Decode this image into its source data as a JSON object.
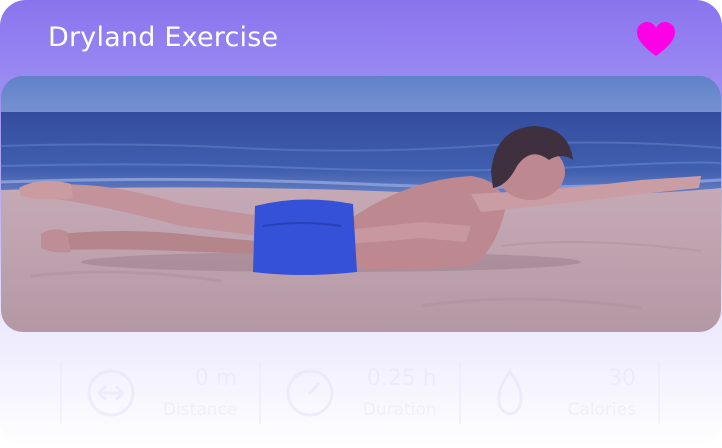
{
  "header": {
    "title": "Dryland Exercise",
    "favorite_icon": "heart-icon",
    "favorite_color": "#ff00e6"
  },
  "stats": [
    {
      "icon": "arrows-horizontal-icon",
      "value": "0 m",
      "label": "Distance"
    },
    {
      "icon": "stopwatch-icon",
      "value": "0.25 h",
      "label": "Duration"
    },
    {
      "icon": "flame-icon",
      "value": "30",
      "label": "Calories"
    }
  ],
  "colors": {
    "accent": "#8a74ee",
    "heart": "#ff00e6"
  }
}
